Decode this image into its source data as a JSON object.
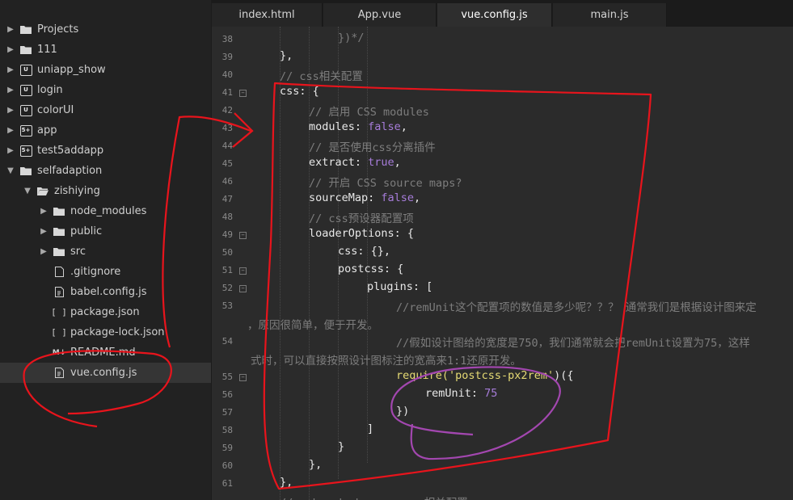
{
  "tabs": [
    {
      "label": "index.html",
      "active": false
    },
    {
      "label": "App.vue",
      "active": false
    },
    {
      "label": "vue.config.js",
      "active": true
    },
    {
      "label": "main.js",
      "active": false
    }
  ],
  "sidebar": {
    "items": [
      {
        "label": "Projects",
        "icon": "folder-icon"
      },
      {
        "label": "111",
        "icon": "folder-icon"
      },
      {
        "label": "uniapp_show",
        "icon": "uniapp-icon"
      },
      {
        "label": "login",
        "icon": "uniapp-icon"
      },
      {
        "label": "colorUI",
        "icon": "uniapp-icon"
      },
      {
        "label": "app",
        "icon": "html5plus-icon"
      },
      {
        "label": "test5addapp",
        "icon": "html5plus-icon"
      },
      {
        "label": "selfadaption",
        "icon": "folder-icon"
      },
      {
        "label": "zishiying",
        "icon": "folder-icon"
      },
      {
        "label": "node_modules",
        "icon": "folder-icon"
      },
      {
        "label": "public",
        "icon": "folder-icon"
      },
      {
        "label": "src",
        "icon": "folder-icon"
      },
      {
        "label": ".gitignore",
        "icon": "file-icon"
      },
      {
        "label": "babel.config.js",
        "icon": "js-file-icon"
      },
      {
        "label": "package.json",
        "icon": "json-file-icon"
      },
      {
        "label": "package-lock.json",
        "icon": "json-file-icon"
      },
      {
        "label": "README.md",
        "icon": "markdown-file-icon"
      },
      {
        "label": "vue.config.js",
        "icon": "js-file-icon",
        "selected": true
      }
    ],
    "badge_texts": {
      "uniapp": "U",
      "html5plus": "5+",
      "json": "[ ]",
      "md": "M↓"
    }
  },
  "editor": {
    "line_numbers": [
      "38",
      "39",
      "40",
      "41",
      "42",
      "43",
      "44",
      "45",
      "46",
      "47",
      "48",
      "49",
      "50",
      "51",
      "52",
      "53",
      "54",
      "55",
      "56",
      "57",
      "58",
      "59",
      "60",
      "61"
    ],
    "code": {
      "l38": "})*/",
      "l39": "},",
      "l40": "// css相关配置",
      "l41": "css: {",
      "l42": "// 启用 CSS modules",
      "l43_key": "modules: ",
      "l43_val": "false",
      "l44": "// 是否使用css分离插件",
      "l45_key": "extract: ",
      "l45_val": "true",
      "l46": "// 开启 CSS source maps?",
      "l47_key": "sourceMap: ",
      "l47_val": "false",
      "l48": "// css预设器配置项",
      "l49": "loaderOptions: {",
      "l50": "css: {},",
      "l51": "postcss: {",
      "l52": "plugins: [",
      "l53a": "//remUnit这个配置项的数值是多少呢？？？ 通常我们是根据设计图来定",
      "l53b": "，原因很简单，便于开发。",
      "l54a": "//假如设计图给的宽度是750，我们通常就会把remUnit设置为75，这样",
      "l54b": "式时，可以直接按照设计图标注的宽高来1:1还原开发。",
      "l55_fn": "require(",
      "l55_str": "'postcss-px2rem'",
      "l55_end": ")({",
      "l56_key": "remUnit: ",
      "l56_val": "75",
      "l57": "})",
      "l58": "]",
      "l59": "}",
      "l60": "},",
      "l61": "},",
      "l62": "// webpack-dev-server 相关配置"
    }
  },
  "colors": {
    "annotation_red": "#e8141c",
    "annotation_purple": "#a347b0"
  }
}
